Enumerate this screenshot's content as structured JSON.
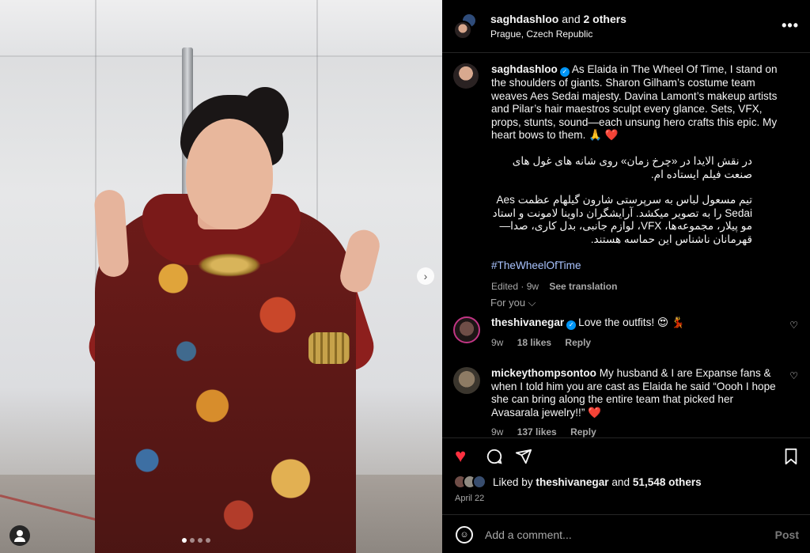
{
  "header": {
    "username": "saghdashloo",
    "and_text": " and ",
    "others": "2 others",
    "location": "Prague, Czech Republic",
    "more_icon": "more-horizontal-icon"
  },
  "caption": {
    "username": "saghdashloo",
    "text_en": "As Elaida in The Wheel Of Time, I stand on the shoulders of giants. Sharon Gilham’s costume team weaves Aes Sedai majesty. Davina Lamont’s makeup artists and Pilar’s hair maestros sculpt every glance. Sets, VFX, props, stunts, sound—each unsung hero crafts this epic. My heart bows to them. 🙏 ❤️",
    "text_fa_1": "در نقش الایدا در «چرخ زمان» روی شانه های غول های صنعت فیلم ایستاده ام.",
    "text_fa_2": "تیم مسعول لباس به سرپرستی شارون گیلهام عظمت Aes Sedai را به تصویر میکشد. آرایشگران داوینا لامونت و استاد مو پیلار، مجموعه‌ها، VFX، لوازم جانبی، بدل کاری، صدا—قهرمانان ناشناس این حماسه هستند.",
    "hashtag": "#TheWheelOfTime",
    "edited": "Edited · 9w",
    "see_translation": "See translation"
  },
  "for_you": "For you ⌵",
  "comments": [
    {
      "username": "theshivanegar",
      "text": "Love the outfits! 😍 💃",
      "time": "9w",
      "likes": "18 likes",
      "reply": "Reply"
    },
    {
      "username": "mickeythompsontoo",
      "text": "My husband & I are Expanse fans & when I told him you are cast as Elaida he said “Oooh I hope she can bring along the entire team that picked her Avasarala jewelry!!” ❤️",
      "time": "9w",
      "likes": "137 likes",
      "reply": "Reply"
    }
  ],
  "actions": {
    "like_icon": "♥",
    "comment_icon": "◯",
    "share_icon": "➤",
    "save_icon": "⛉",
    "like_color": "#ff3040"
  },
  "likes_line": {
    "prefix": "Liked by ",
    "user": "theshivanegar",
    "middle": " and ",
    "count": "51,548 others"
  },
  "date": "April 22",
  "add_comment": {
    "placeholder": "Add a comment...",
    "post": "Post"
  },
  "photo": {
    "next_icon": "›"
  }
}
